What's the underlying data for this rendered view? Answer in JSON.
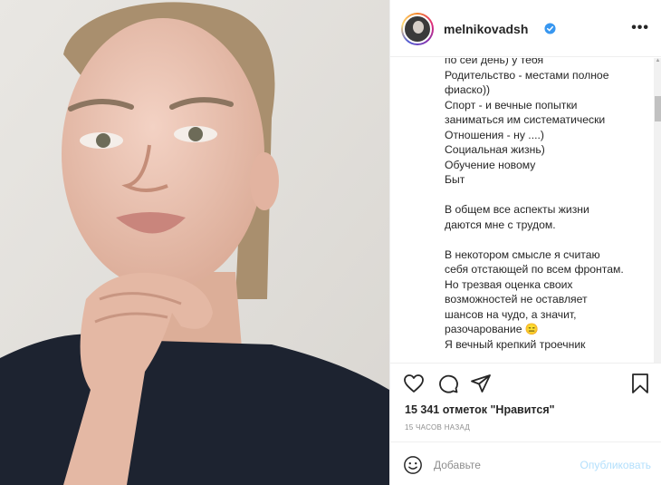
{
  "post": {
    "username": "melnikovadsh",
    "more_label": "•••"
  },
  "caption": {
    "lines": [
      "по сей день) у тебя",
      "Родительство - местами полное",
      "фиаско))",
      "Спорт - и вечные попытки",
      "заниматься им систематически",
      "Отношения - ну ....)",
      "Социальная жизнь)",
      "Обучение новому",
      "Быт",
      "",
      "В общем все аспекты жизни",
      "даются мне с трудом.",
      "",
      "В некотором смысле я считаю",
      "себя отстающей по всем фронтам.",
      "Но трезвая оценка своих",
      "возможностей не оставляет",
      "шансов на чудо, а значит,",
      "разочарование 😑",
      "Я вечный крепкий троечник"
    ]
  },
  "actions": {
    "likes_text": "15 341 отметок \"Нравится\"",
    "time_ago": "15 ЧАСОВ НАЗАД"
  },
  "comment": {
    "placeholder": "Добавьте",
    "publish_label": "Опубликовать"
  },
  "colors": {
    "verified": "#3897f0",
    "publish_disabled": "#b2dffc",
    "muted_text": "#8e8e8e"
  }
}
